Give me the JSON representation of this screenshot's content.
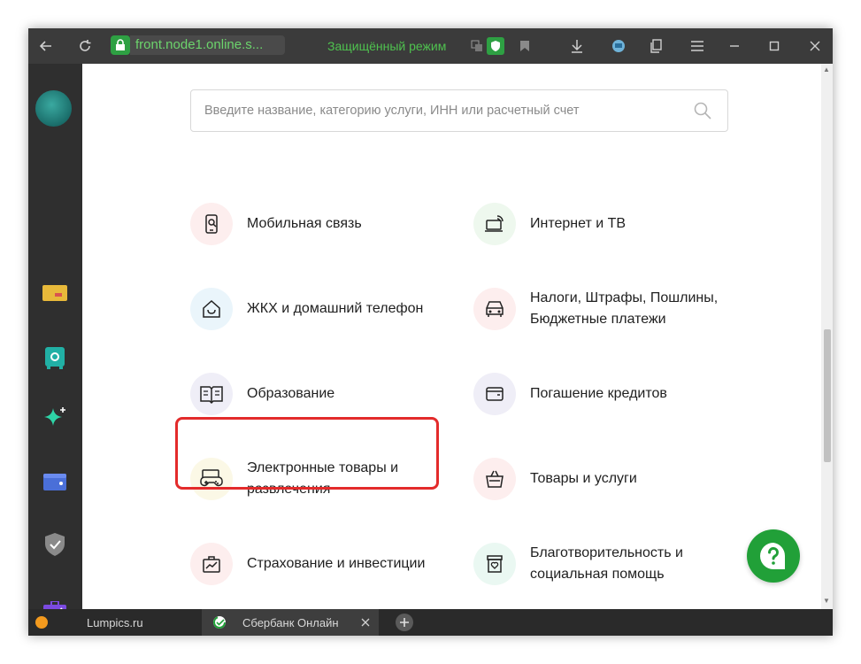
{
  "browser": {
    "url": "front.node1.online.s...",
    "secure_mode_label": "Защищённый режим"
  },
  "search": {
    "placeholder": "Введите название, категорию услуги, ИНН или расчетный счет",
    "value": ""
  },
  "categories": [
    {
      "label": "Мобильная связь",
      "icon": "mobile-phone-icon"
    },
    {
      "label": "Интернет и ТВ",
      "icon": "laptop-wifi-icon"
    },
    {
      "label": "ЖКХ и домашний телефон",
      "icon": "house-icon"
    },
    {
      "label": "Налоги, Штрафы, Пошлины, Бюджетные платежи",
      "icon": "car-icon"
    },
    {
      "label": "Образование",
      "icon": "open-book-icon"
    },
    {
      "label": "Погашение кредитов",
      "icon": "wallet-icon"
    },
    {
      "label": "Электронные товары и развлечения",
      "icon": "gamepad-icon"
    },
    {
      "label": "Товары и услуги",
      "icon": "basket-icon"
    },
    {
      "label": "Страхование и инвестиции",
      "icon": "chart-briefcase-icon"
    },
    {
      "label": "Благотворительность и социальная помощь",
      "icon": "charity-box-icon"
    }
  ],
  "tabs": [
    {
      "label": "Lumpics.ru"
    },
    {
      "label": "Сбербанк Онлайн"
    }
  ],
  "colors": {
    "accent": "#21a038",
    "highlight": "#e32b2b"
  }
}
